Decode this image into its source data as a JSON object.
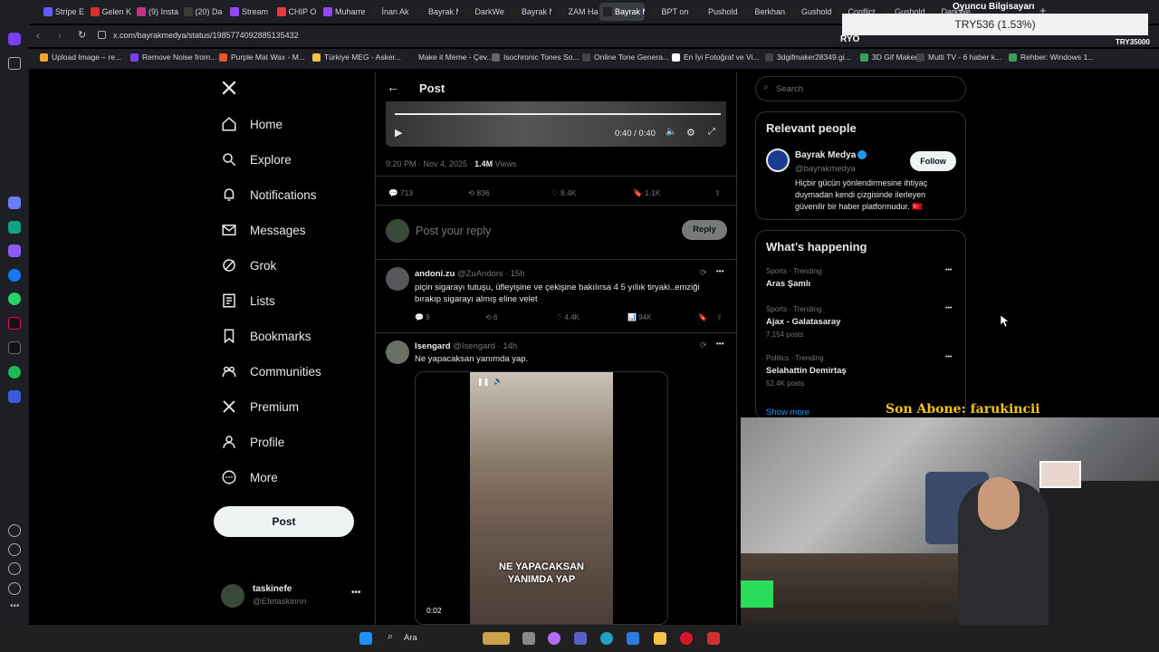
{
  "browser": {
    "url": "x.com/bayrakmedya/status/1985774092885135432",
    "tabs": [
      "Stripe E",
      "Gelen K",
      "(9) Insta",
      "(20) Da",
      "Stream",
      "CHIP O",
      "Muharre",
      "İnan Ak",
      "Bayrak M",
      "DarkWe",
      "Bayrak M",
      "ZAM Ha",
      "Bayrak Medya",
      "BPT on",
      "Pushold",
      "Berkhan",
      "Gushold",
      "Conflict",
      "Gushold",
      "DarkWe"
    ],
    "bookmarks": [
      "Upload Image – re...",
      "Remove Noise from...",
      "Purple Mat Wax - M...",
      "Türkiye MEG - Asker...",
      "Make it Meme - Çev...",
      "Isochronic Tones So...",
      "Online Tone Genera...",
      "En İyi Fotoğraf ve Vi...",
      "3dgifmaker28349.gi...",
      "3D Gif Maker",
      "Multi TV - 6 haber k...",
      "Rehber: Windows 1..."
    ]
  },
  "overlay": {
    "title": "Oyuncu Bilgisayarı",
    "ticker": "TRY536 (1.53%)",
    "left_tag": "RYO",
    "right_tag": "TRY35000",
    "subscriber": "Son Abone: farukincii"
  },
  "nav": {
    "items": [
      "Home",
      "Explore",
      "Notifications",
      "Messages",
      "Grok",
      "Lists",
      "Bookmarks",
      "Communities",
      "Premium",
      "Profile",
      "More"
    ],
    "post_button": "Post",
    "account_name": "taskinefe",
    "account_handle": "@Efetaskinnn"
  },
  "post": {
    "header": "Post",
    "video_time": "0:40 / 0:40",
    "timestamp": "9:20 PM · Nov 4, 2025 ·",
    "views_count": "1.4M",
    "views_label": "Views",
    "replies": "713",
    "reposts": "836",
    "likes": "8.4K",
    "bookmarks": "1.1K",
    "reply_placeholder": "Post your reply",
    "reply_button": "Reply"
  },
  "replies": [
    {
      "name": "andoni.zu",
      "handle": "@ZuAndoni",
      "time": "· 15h",
      "text": "piçin sigarayı tutuşu, üfleyişine ve çekişine bakılırsa 4 5 yıllık tiryaki..emziği bırakıp sigarayı almış eline velet",
      "replies": "9",
      "reposts": "6",
      "likes": "4.4K",
      "views": "94K"
    },
    {
      "name": "Isengard",
      "handle": "@Isengard",
      "time": "· 14h",
      "text": "Ne yapacaksan yanımda yap.",
      "video_caption": "NE YAPACAKSAN\nYANIMDA YAP",
      "video_time": "0:02"
    }
  ],
  "right": {
    "search_placeholder": "Search",
    "relevant_title": "Relevant people",
    "person_name": "Bayrak Medya",
    "person_handle": "@bayrakmedya",
    "follow_label": "Follow",
    "person_bio": "Hiçbir gücün yönlendirmesine ihtiyaç duymadan kendi çizgisinde ilerleyen güvenilir bir haber platformudur. 🇹🇷",
    "happening_title": "What’s happening",
    "trends": [
      {
        "context": "Sports · Trending",
        "name": "Aras Şamlı",
        "posts": ""
      },
      {
        "context": "Sports · Trending",
        "name": "Ajax - Galatasaray",
        "posts": "7,154 posts"
      },
      {
        "context": "Politics · Trending",
        "name": "Selahattin Demirtaş",
        "posts": "52.4K posts"
      }
    ],
    "show_more": "Show more"
  },
  "taskbar": {
    "search_label": "Ara"
  },
  "colors": {
    "accent": "#1d9bf0",
    "bg": "#000000",
    "border": "#2f3336",
    "muted": "#71767b",
    "subscriber_text": "#f5c518"
  }
}
